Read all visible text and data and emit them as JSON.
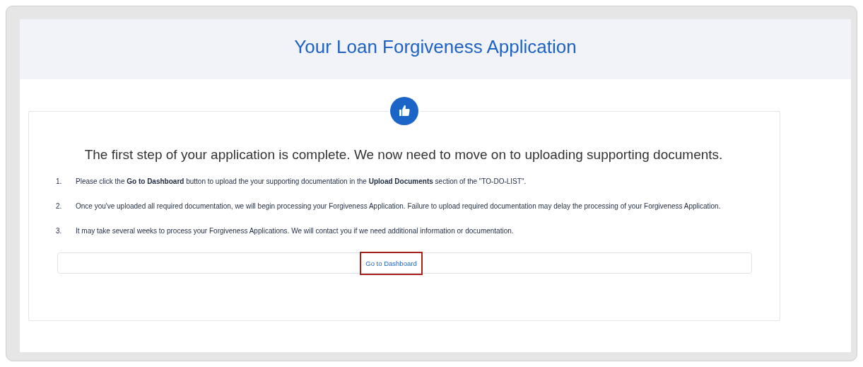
{
  "header": {
    "title": "Your Loan Forgiveness Application"
  },
  "card": {
    "heading": "The first step of your application is complete. We now need to move on to uploading supporting documents.",
    "steps": [
      {
        "number": "1.",
        "text": "Please click the **Go to Dashboard** button to upload the your supporting documentation in the **Upload Documents** section of the \"TO-DO-LIST\"."
      },
      {
        "number": "2.",
        "text": "Once you've uploaded all required documentation, we will begin processing your Forgiveness Application. Failure to upload required documentation may delay the processing of your Forgiveness Application."
      },
      {
        "number": "3.",
        "text": "It may take several weeks to process your Forgiveness Applications. We will contact you if we need additional information or documentation."
      }
    ],
    "button": {
      "label": "Go to Dashboard",
      "highlighted": true
    }
  }
}
